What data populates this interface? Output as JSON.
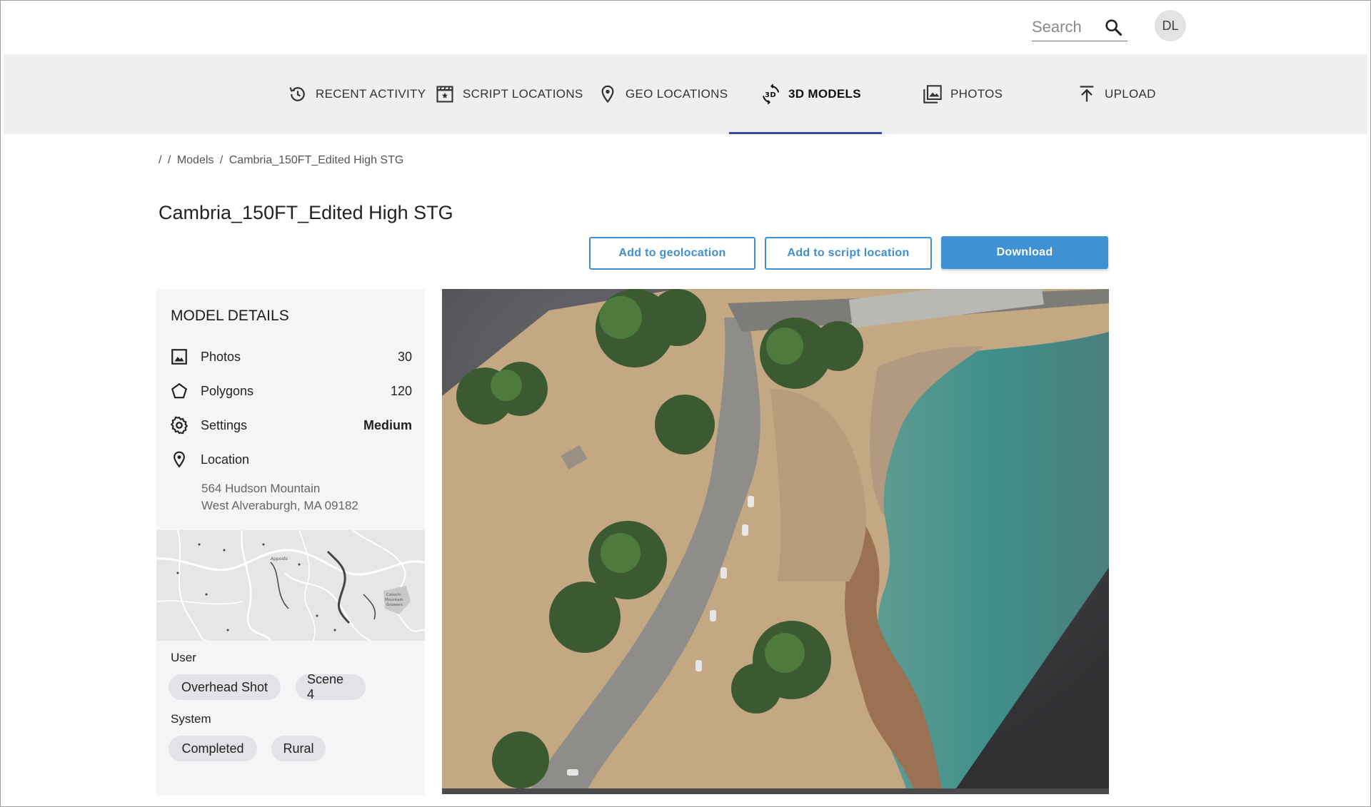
{
  "header": {
    "search_placeholder": "Search",
    "avatar_initials": "DL"
  },
  "nav": {
    "items": [
      {
        "label": "RECENT ACTIVITY",
        "icon": "history-icon"
      },
      {
        "label": "SCRIPT LOCATIONS",
        "icon": "clapperboard-icon"
      },
      {
        "label": "GEO LOCATIONS",
        "icon": "map-pin-icon"
      },
      {
        "label": "3D MODELS",
        "icon": "3d-rotate-icon",
        "active": true
      },
      {
        "label": "PHOTOS",
        "icon": "photo-library-icon"
      },
      {
        "label": "UPLOAD",
        "icon": "upload-icon"
      }
    ],
    "accent_color": "#3949ab"
  },
  "breadcrumb": {
    "sep1": "/",
    "sep2": "/",
    "models": "Models",
    "sep3": "/",
    "current": "Cambria_150FT_Edited High STG"
  },
  "page": {
    "title": "Cambria_150FT_Edited High STG"
  },
  "actions": {
    "add_geolocation": "Add to geolocation",
    "add_script_location": "Add to script location",
    "download": "Download",
    "primary_color": "#3f91d3"
  },
  "details": {
    "title": "MODEL DETAILS",
    "photos_label": "Photos",
    "photos_value": "30",
    "polygons_label": "Polygons",
    "polygons_value": "120",
    "settings_label": "Settings",
    "settings_value": "Medium",
    "location_label": "Location",
    "address_line1": "564 Hudson Mountain",
    "address_line2": "West Alveraburgh, MA 09182",
    "map_labels": {
      "town": "Appoids",
      "poi_line1": "Catochi",
      "poi_line2": "Mountain",
      "poi_line3": "Growers"
    }
  },
  "tags": {
    "user_label": "User",
    "user_tags": [
      "Overhead Shot",
      "Scene 4"
    ],
    "system_label": "System",
    "system_tags": [
      "Completed",
      "Rural"
    ]
  }
}
